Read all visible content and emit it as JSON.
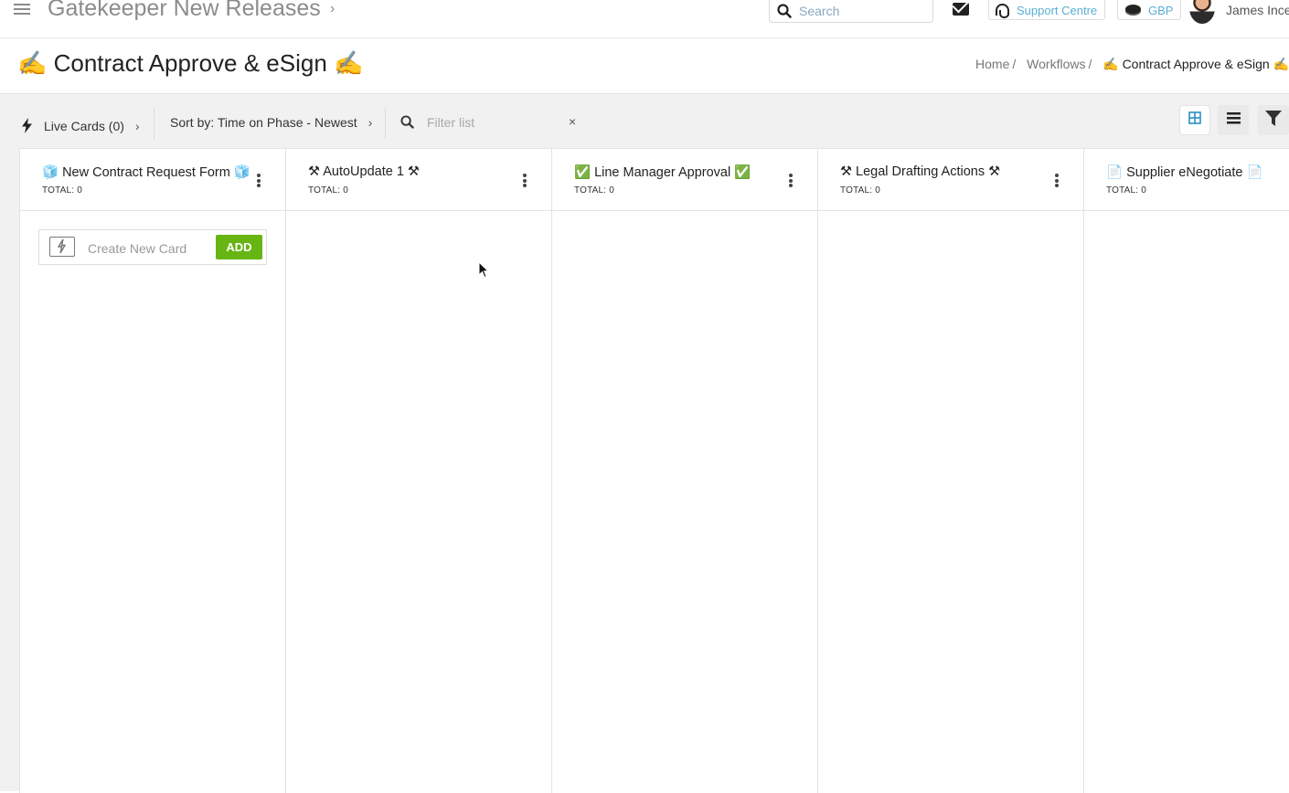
{
  "topbar": {
    "app_title": "Gatekeeper New Releases",
    "title_chevron": "›",
    "search_placeholder": "Search",
    "support_label": "Support Centre",
    "currency_label": "GBP",
    "user_name": "James Ince"
  },
  "header": {
    "page_title": "✍️ Contract Approve & eSign ✍️",
    "breadcrumb": {
      "home": "Home",
      "workflows": "Workflows",
      "separator": "/",
      "current": "✍️ Contract Approve & eSign ✍"
    }
  },
  "toolbar": {
    "live_cards_label": "Live Cards (0)",
    "sort_label": "Sort by: Time on Phase - Newest",
    "chevron": "›",
    "filter_placeholder": "Filter list",
    "filter_clear": "×"
  },
  "columns": [
    {
      "title": "🧊 New Contract Request Form 🧊",
      "total": "TOTAL: 0"
    },
    {
      "title": "⚒ AutoUpdate 1 ⚒",
      "total": "TOTAL: 0"
    },
    {
      "title": "✅ Line Manager Approval ✅",
      "total": "TOTAL: 0"
    },
    {
      "title": "⚒ Legal Drafting Actions ⚒",
      "total": "TOTAL: 0"
    },
    {
      "title": "📄 Supplier eNegotiate 📄",
      "total": "TOTAL: 0"
    }
  ],
  "new_card": {
    "placeholder": "Create New Card",
    "add_label": "ADD"
  },
  "colors": {
    "add_button": "#67b513",
    "link": "#5aaed3",
    "grid_view_active": "#2a8fc4"
  },
  "icons": {
    "menu": "hamburger-icon",
    "search": "search-icon",
    "mail": "envelope-icon",
    "support": "headset-icon",
    "currency": "coins-icon",
    "live_cards": "lightning-bolt-icon",
    "grid_view": "grid-view-icon",
    "list_view": "list-view-icon",
    "filter": "filter-funnel-icon",
    "column_menu": "kebab-menu-icon"
  }
}
